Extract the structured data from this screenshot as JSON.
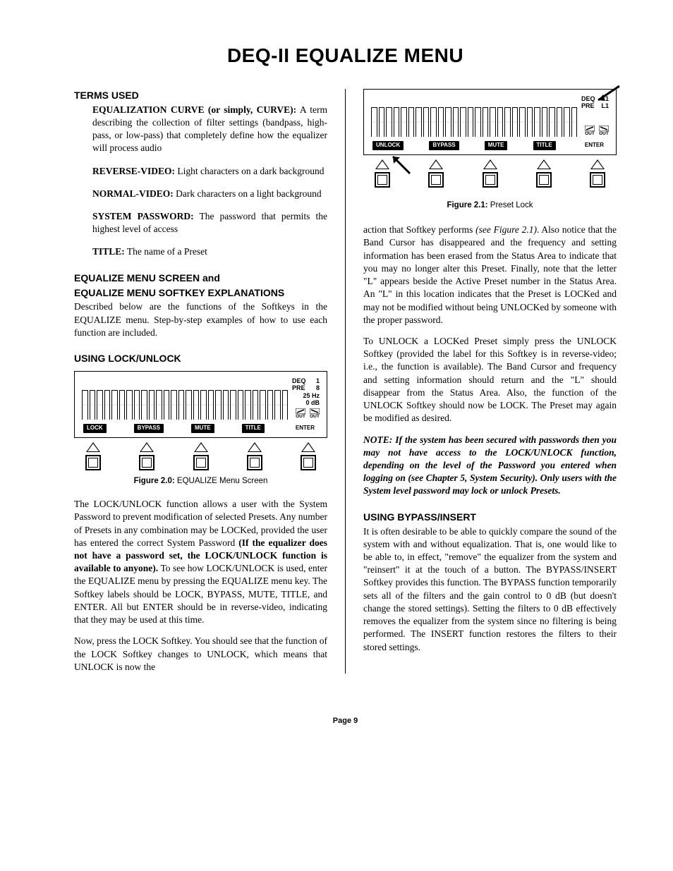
{
  "page_title": "DEQ-II EQUALIZE MENU",
  "page_number_label": "Page 9",
  "left": {
    "terms_heading": "TERMS USED",
    "terms": [
      {
        "name": "EQUALIZATION CURVE (or simply, CURVE):",
        "body": "A term describing the collection of filter settings (bandpass, high-pass, or low-pass) that completely define how the equalizer will process audio"
      },
      {
        "name": "REVERSE-VIDEO:",
        "body": "Light characters on a dark background"
      },
      {
        "name": "NORMAL-VIDEO:",
        "body": "Dark characters on a light background"
      },
      {
        "name": "SYSTEM PASSWORD:",
        "body": "The password that permits the highest level of access"
      },
      {
        "name": "TITLE:",
        "body": "The name of a Preset"
      }
    ],
    "eq_menu_heading_1": "EQUALIZE MENU SCREEN and",
    "eq_menu_heading_2": "EQUALIZE MENU SOFTKEY EXPLANATIONS",
    "eq_menu_body": "Described below are the functions of the Softkeys in the EQUALIZE menu.  Step-by-step examples of how to use each function are included.",
    "lockunlock_heading": "USING LOCK/UNLOCK",
    "fig20_caption_bold": "Figure 2.0:",
    "fig20_caption_rest": "  EQUALIZE Menu Screen",
    "fig20": {
      "status": {
        "line1_l": "DEQ",
        "line1_r": "1",
        "line2_l": "PRE",
        "line2_r": "8",
        "line3": "25 Hz",
        "line4": "0 dB"
      },
      "out_l": "OUT",
      "out_r": "OUT",
      "softkeys": [
        "LOCK",
        "BYPASS",
        "MUTE",
        "TITLE",
        "ENTER"
      ]
    },
    "lock_p1_a": "The LOCK/UNLOCK function allows a user with the System Password to prevent modification of selected Presets.  Any number of Presets in any combination may be LOCKed, provided the user has entered the correct System Password ",
    "lock_p1_bold": "(If the equalizer does not have a password set, the LOCK/UNLOCK function is available to anyone).",
    "lock_p1_b": "  To see how LOCK/UNLOCK is used, enter the EQUALIZE menu by pressing the EQUALIZE menu key.  The Softkey labels should be LOCK, BYPASS, MUTE, TITLE, and ENTER.  All but ENTER should be in reverse-video, indicating that they may be used at this time.",
    "lock_p2": "Now, press the LOCK Softkey.  You should see that the function of the LOCK Softkey changes to UNLOCK, which means that UNLOCK is now the"
  },
  "right": {
    "fig21_caption_bold": "Figure 2.1:",
    "fig21_caption_rest": "  Preset Lock",
    "fig21": {
      "status": {
        "line1_l": "DEQ",
        "line1_r": "1",
        "line2_l": "PRE",
        "line2_r": "L1"
      },
      "out_l": "OUT",
      "out_r": "OUT",
      "softkeys": [
        "UNLOCK",
        "BYPASS",
        "MUTE",
        "TITLE",
        "ENTER"
      ]
    },
    "p1_a": "action that Softkey performs ",
    "p1_ital": "(see Figure 2.1)",
    "p1_b": ".  Also notice that the Band Cursor has disappeared and the frequency and setting information has been erased from the Status Area to indicate that you may no longer alter this Preset.  Finally, note that the letter \"L\" appears beside the Active Preset number in the Status Area.  An \"L\" in this location indicates that the Preset is LOCKed and may not be modified without being UNLOCKed by someone with the proper password.",
    "p2": "To UNLOCK a LOCKed Preset simply press the UNLOCK Softkey (provided the label for this Softkey is in reverse-video; i.e., the function is available). The Band Cursor and frequency and setting information should return and the \"L\" should disappear from the Status Area. Also, the function of the UNLOCK Softkey should now be LOCK.  The Preset may again be modified as desired.",
    "note": "NOTE: If the system has been secured with passwords then you may not have access to the LOCK/UNLOCK function, depending on the level of the Password you entered when logging on (see Chapter 5, System Security).  Only users with the System level password may lock or unlock Presets.",
    "bypass_heading": "USING BYPASS/INSERT",
    "bypass_body": "It is often desirable to be able to quickly compare the sound of the system with and without equalization. That is, one would like to be able to, in effect, \"remove\" the equalizer from the system and \"reinsert\" it at the touch of a button. The BYPASS/INSERT Softkey provides this function. The BYPASS function temporarily sets all of the filters and the gain control to 0 dB (but doesn't change the stored settings).  Setting the filters to 0 dB effectively removes the equalizer from the system since no filtering is being performed.  The INSERT function restores the filters to their stored settings."
  }
}
